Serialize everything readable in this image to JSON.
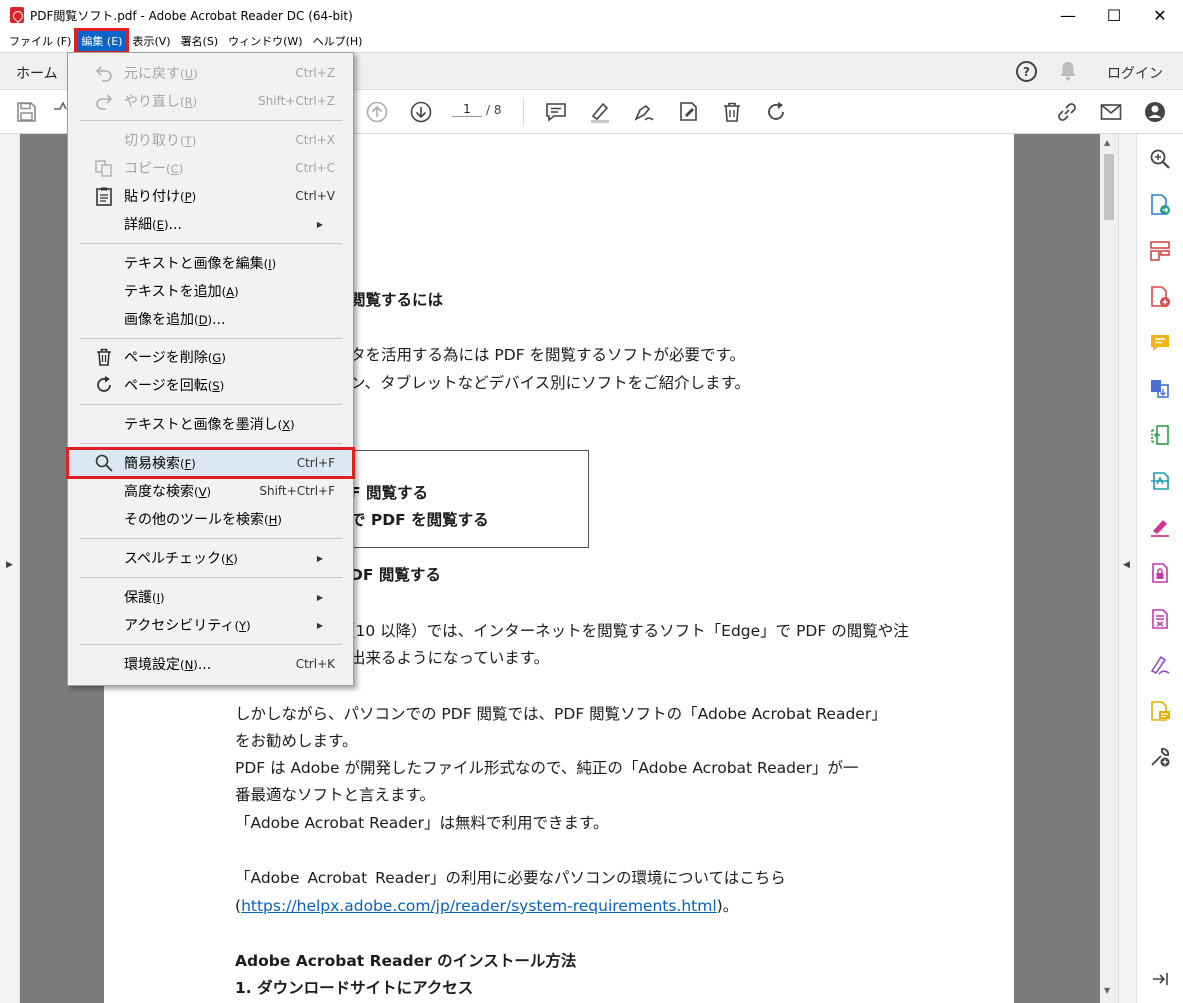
{
  "window": {
    "title": "PDF閲覧ソフト.pdf - Adobe Acrobat Reader DC (64-bit)",
    "minimize": "—",
    "maximize": "☐",
    "close": "✕"
  },
  "menubar": [
    {
      "label": "ファイル (F)"
    },
    {
      "label": "編集 (E)",
      "active": true
    },
    {
      "label": "表示(V)"
    },
    {
      "label": "署名(S)"
    },
    {
      "label": "ウィンドウ(W)"
    },
    {
      "label": "ヘルプ(H)"
    }
  ],
  "tabbar": {
    "home": "ホーム",
    "help": "?",
    "login": "ログイン"
  },
  "toolbar": {
    "page_current": "1",
    "page_total": "/ 8"
  },
  "edit_menu": {
    "undo": {
      "label": "元に戻す",
      "key": "U",
      "shortcut": "Ctrl+Z"
    },
    "redo": {
      "label": "やり直し",
      "key": "R",
      "shortcut": "Shift+Ctrl+Z"
    },
    "cut": {
      "label": "切り取り",
      "key": "T",
      "shortcut": "Ctrl+X"
    },
    "copy": {
      "label": "コピー",
      "key": "C",
      "shortcut": "Ctrl+C"
    },
    "paste": {
      "label": "貼り付け",
      "key": "P",
      "shortcut": "Ctrl+V"
    },
    "more": {
      "label": "詳細",
      "key": "E",
      "suffix": "..."
    },
    "edit_text": {
      "label": "テキストと画像を編集",
      "key": "I"
    },
    "add_text": {
      "label": "テキストを追加",
      "key": "A"
    },
    "add_image": {
      "label": "画像を追加",
      "key": "D",
      "suffix": "..."
    },
    "delete_page": {
      "label": "ページを削除",
      "key": "G"
    },
    "rotate_page": {
      "label": "ページを回転",
      "key": "S"
    },
    "redact": {
      "label": "テキストと画像を墨消し",
      "key": "X"
    },
    "find": {
      "label": "簡易検索",
      "key": "F",
      "shortcut": "Ctrl+F"
    },
    "adv_search": {
      "label": "高度な検索",
      "key": "V",
      "shortcut": "Shift+Ctrl+F"
    },
    "search_tools": {
      "label": "その他のツールを検索",
      "key": "H"
    },
    "spell": {
      "label": "スペルチェック",
      "key": "K"
    },
    "protect": {
      "label": "保護",
      "key": "I"
    },
    "accessibility": {
      "label": "アクセシビリティ",
      "key": "Y"
    },
    "prefs": {
      "label": "環境設定",
      "key": "N",
      "suffix": "...",
      "shortcut": "Ctrl+K"
    }
  },
  "document": {
    "lines": [
      "閲覧するには",
      "タを活用する為には PDF を閲覧するソフトが必要です。",
      "ン、タブレットなどデバイス別にソフトをご紹介します。",
      "F 閲覧する",
      "で PDF を閲覧する",
      "DF 閲覧する",
      "（10 以降）では、インターネットを閲覧するソフト「Edge」で PDF の閲覧や注",
      "出来るようになっています。",
      "しかしながら、パソコンでの PDF 閲覧では、PDF 閲覧ソフトの「Adobe Acrobat Reader」",
      "をお勧めします。",
      "PDF は Adobe が開発したファイル形式なので、純正の「Adobe Acrobat Reader」が一",
      "番最適なソフトと言えます。",
      "「Adobe Acrobat Reader」は無料で利用できます。",
      "「Adobe Acrobat Reader」の利用に必要なパソコンの環境についてはこちら",
      "Adobe Acrobat Reader のインストール方法",
      "1.  ダウンロードサイトにアクセス"
    ],
    "link_open": "(",
    "link": "https://helpx.adobe.com/jp/reader/system-requirements.html",
    "link_close": ")。"
  }
}
